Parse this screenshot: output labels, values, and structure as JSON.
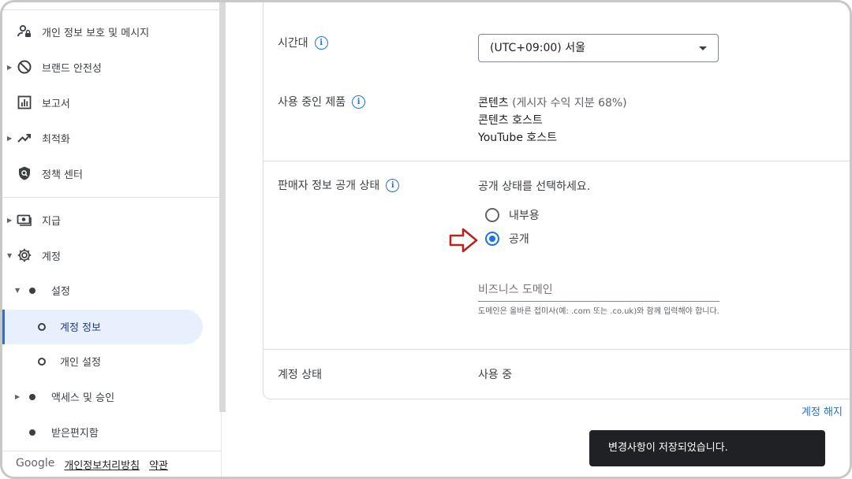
{
  "sidebar": {
    "items": [
      {
        "label": "개인 정보 보호 및 메시지",
        "icon": "privacy-person-lock-icon"
      },
      {
        "label": "브랜드 안전성",
        "icon": "block-icon"
      },
      {
        "label": "보고서",
        "icon": "bar-chart-icon"
      },
      {
        "label": "최적화",
        "icon": "trending-up-icon"
      },
      {
        "label": "정책 센터",
        "icon": "shield-policy-icon"
      },
      {
        "label": "지급",
        "icon": "payments-icon"
      },
      {
        "label": "계정",
        "icon": "gear-icon"
      }
    ],
    "sub_items": {
      "settings": "설정",
      "account_info": "계정 정보",
      "personal_settings": "개인 설정",
      "access": "액세스 및 승인",
      "inbox": "받은편지함"
    }
  },
  "footer": {
    "brand": "Google",
    "privacy_link": "개인정보처리방침",
    "terms_link": "약관"
  },
  "main": {
    "timezone": {
      "label": "시간대",
      "value": "(UTC+09:00) 서울"
    },
    "products": {
      "label": "사용 중인 제품",
      "line1": "콘텐츠",
      "line1_detail": " (게시자 수익 지분 68%)",
      "line2": "콘텐츠 호스트",
      "line3": "YouTube 호스트"
    },
    "seller_info": {
      "label": "판매자 정보 공개 상태",
      "prompt": "공개 상태를 선택하세요.",
      "options": [
        "내부용",
        "공개"
      ],
      "selected": "공개",
      "domain_placeholder": "비즈니스 도메인",
      "domain_hint": "도메인은 올바른 접미사(예: .com 또는 .co.uk)와 함께 입력해야 합니다."
    },
    "account_status": {
      "label": "계정 상태",
      "value": "사용 중"
    },
    "close_account_link": "계정 해지"
  },
  "toast": {
    "message": "변경사항이 저장되었습니다."
  },
  "colors": {
    "accent": "#1a73e8",
    "annotation_arrow": "#b3261e",
    "toast_bg": "#202124",
    "active_bg": "#e8f0fe"
  }
}
